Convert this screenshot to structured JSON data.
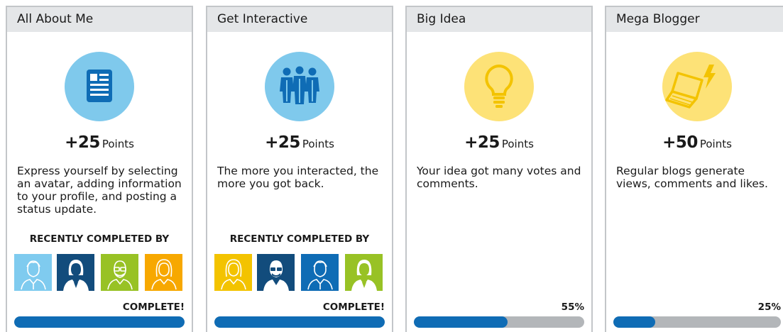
{
  "colors": {
    "header_bg": "#e4e6e8",
    "card_border": "#c3c6c9",
    "progress_fill": "#0f6cb5",
    "progress_track": "#b3b6b9",
    "icon_blue_bg": "#7fc9ec",
    "icon_yellow_bg": "#fde277"
  },
  "points_label": "Points",
  "recent_title": "RECENTLY COMPLETED BY",
  "cards": [
    {
      "title": "All About Me",
      "icon": "profile-document-icon",
      "points": "+25",
      "description": "Express yourself by selecting an avatar, adding information to your profile, and posting a status update.",
      "avatars": [
        {
          "name": "avatar-man-light-blue",
          "bg": "#7fcbef"
        },
        {
          "name": "avatar-woman-dark-blue",
          "bg": "#124c7c"
        },
        {
          "name": "avatar-man-glasses-green",
          "bg": "#98c225"
        },
        {
          "name": "avatar-woman-orange",
          "bg": "#f7a800"
        }
      ],
      "status": "COMPLETE!",
      "progress": 1.0
    },
    {
      "title": "Get Interactive",
      "icon": "people-group-icon",
      "points": "+25",
      "description": "The more you interacted, the more you got back.",
      "avatars": [
        {
          "name": "avatar-woman-yellow",
          "bg": "#f3c300"
        },
        {
          "name": "avatar-man-glasses-dark-blue",
          "bg": "#124c7c"
        },
        {
          "name": "avatar-man-blue",
          "bg": "#0f6cb5"
        },
        {
          "name": "avatar-woman-green",
          "bg": "#98c225"
        }
      ],
      "status": "COMPLETE!",
      "progress": 1.0
    },
    {
      "title": "Big Idea",
      "icon": "lightbulb-icon",
      "points": "+25",
      "description": "Your idea got many votes and comments.",
      "avatars": [],
      "status": "55%",
      "progress": 0.55
    },
    {
      "title": "Mega Blogger",
      "icon": "laptop-lightning-icon",
      "points": "+50",
      "description": "Regular blogs generate views, comments and likes.",
      "avatars": [],
      "status": "25%",
      "progress": 0.25
    }
  ]
}
